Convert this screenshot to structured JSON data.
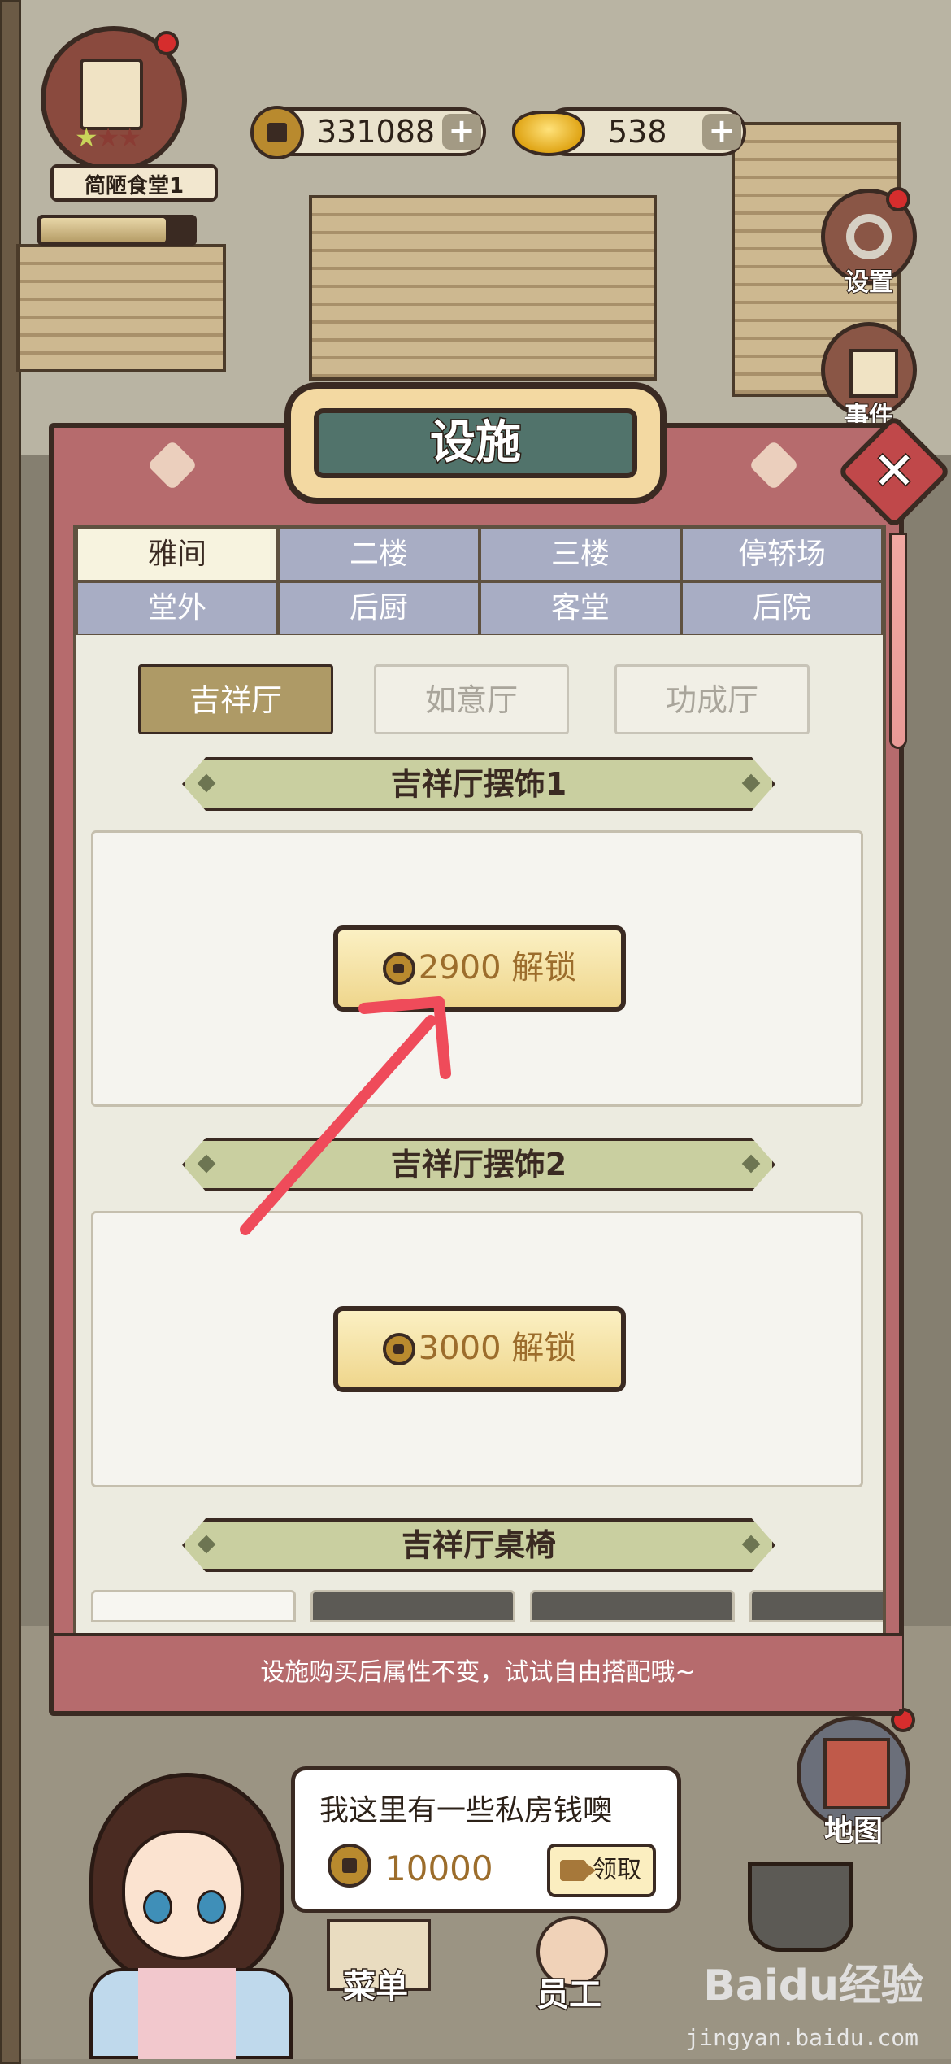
{
  "hud": {
    "shop_name": "简陋食堂1",
    "shop_level_stars": 1,
    "shop_level_max_stars": 3,
    "shop_progress": 0.82,
    "coins": "331088",
    "ingots": "538",
    "plus": "+"
  },
  "side_buttons": {
    "settings": "设置",
    "events": "事件",
    "map": "地图"
  },
  "modal": {
    "title": "设施",
    "close_glyph": "✕",
    "tabs": [
      {
        "label": "雅间",
        "active": true
      },
      {
        "label": "二楼",
        "active": false
      },
      {
        "label": "三楼",
        "active": false
      },
      {
        "label": "停轿场",
        "active": false
      },
      {
        "label": "堂外",
        "active": false
      },
      {
        "label": "后厨",
        "active": false
      },
      {
        "label": "客堂",
        "active": false
      },
      {
        "label": "后院",
        "active": false
      }
    ],
    "subtabs": [
      {
        "label": "吉祥厅",
        "active": true
      },
      {
        "label": "如意厅",
        "active": false
      },
      {
        "label": "功成厅",
        "active": false
      }
    ],
    "sections": [
      {
        "title": "吉祥厅摆饰1",
        "price": "2900",
        "action": "解锁"
      },
      {
        "title": "吉祥厅摆饰2",
        "price": "3000",
        "action": "解锁"
      },
      {
        "title": "吉祥厅桌椅"
      }
    ],
    "footer_hint": "设施购买后属性不变，试试自由搭配哦~"
  },
  "bubble": {
    "text": "我这里有一些私房钱噢",
    "amount": "10000",
    "claim": "领取"
  },
  "bottom_nav": {
    "menu": "菜单",
    "staff": "员工"
  },
  "colors": {
    "modal_pink": "#b66b6d",
    "tab_blue": "#a8adc4",
    "tab_active": "#f7f3df",
    "subtab_active": "#ae9a66",
    "section_green": "#c9cfa0",
    "unlock_gold": "#efd68c",
    "coin_text": "#9c6d2c",
    "annotation_arrow": "#ef4b5a"
  },
  "watermark": {
    "brand": "Baidu经验",
    "site": "jingyan.baidu.com"
  }
}
